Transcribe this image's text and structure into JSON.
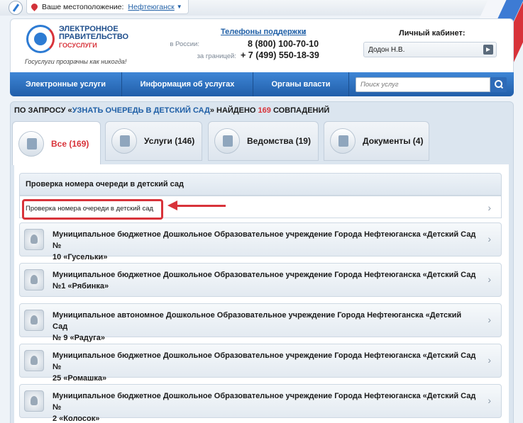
{
  "location": {
    "label": "Ваше местоположение:",
    "city": "Нефтеюганск"
  },
  "logo": {
    "line1": "ЭЛЕКТРОННОЕ",
    "line2": "ПРАВИТЕЛЬСТВО",
    "line3": "ГОСУСЛУГИ",
    "slogan": "Госуслуги прозрачны как никогда!"
  },
  "phones": {
    "title": "Телефоны поддержки",
    "russia_label": "в России:",
    "russia_number": "8 (800) 100-70-10",
    "abroad_label": "за границей:",
    "abroad_number": "+ 7 (499) 550-18-39"
  },
  "cabinet": {
    "title": "Личный кабинет:",
    "user": "Додон Н.В."
  },
  "nav": {
    "items": [
      "Электронные услуги",
      "Информация об услугах",
      "Органы власти"
    ],
    "search_placeholder": "Поиск услуг"
  },
  "query": {
    "prefix": "ПО ЗАПРОСУ «",
    "term": "УЗНАТЬ ОЧЕРЕДЬ В ДЕТСКИЙ САД",
    "mid": "» НАЙДЕНО ",
    "count": "169",
    "suffix": " СОВПАДЕНИЙ"
  },
  "tabs": [
    {
      "label": "Все (169)"
    },
    {
      "label": "Услуги (146)"
    },
    {
      "label": "Ведомства (19)"
    },
    {
      "label": "Документы (4)"
    }
  ],
  "results": {
    "group_title": "Проверка номера очереди в детский сад",
    "group_item": "Проверка номера очереди в детский сад",
    "orgs": [
      {
        "line1": "Муниципальное бюджетное Дошкольное Образовательное учреждение Города Нефтеюганска «Детский Сад №",
        "line2": "10 «Гусельки»"
      },
      {
        "line1": "Муниципальное бюджетное Дошкольное Образовательное учреждение Города Нефтеюганска «Детский Сад",
        "line2": "№1 «Рябинка»"
      },
      {
        "line1": "Муниципальное автономное Дошкольное Образовательное учреждение Города Нефтеюганска «Детский Сад",
        "line2": "№ 9 «Радуга»"
      },
      {
        "line1": "Муниципальное бюджетное Дошкольное Образовательное учреждение Города Нефтеюганска «Детский Сад №",
        "line2": "25 «Ромашка»"
      },
      {
        "line1": "Муниципальное бюджетное Дошкольное Образовательное учреждение Города Нефтеюганска «Детский Сад №",
        "line2": "2 «Колосок»"
      }
    ]
  },
  "colors": {
    "brand_blue": "#215ea9",
    "accent_red": "#d8333a"
  }
}
